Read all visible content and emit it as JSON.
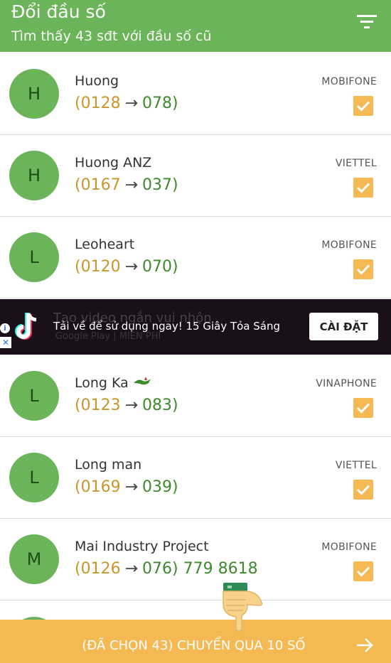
{
  "header": {
    "title": "Đổi đầu số",
    "subtitle": "Tìm thấy 43 sđt với đầu số cũ"
  },
  "contacts": [
    {
      "initial": "H",
      "name": "Huong",
      "old_prefix": "(0128",
      "new_prefix": "078)",
      "rest": "",
      "carrier": "MOBIFONE",
      "checked": true
    },
    {
      "initial": "H",
      "name": "Huong ANZ",
      "old_prefix": "(0167",
      "new_prefix": "037)",
      "rest": "",
      "carrier": "VIETTEL",
      "checked": true
    },
    {
      "initial": "L",
      "name": "Leoheart",
      "old_prefix": "(0120",
      "new_prefix": "070)",
      "rest": "",
      "carrier": "MOBIFONE",
      "checked": true
    },
    {
      "initial": "L",
      "name": "Long Ka",
      "old_prefix": "(0123",
      "new_prefix": "083)",
      "rest": "",
      "carrier": "VINAPHONE",
      "checked": true
    },
    {
      "initial": "L",
      "name": "Long man",
      "old_prefix": "(0169",
      "new_prefix": "039)",
      "rest": "",
      "carrier": "VIETTEL",
      "checked": true
    },
    {
      "initial": "M",
      "name": "Mai Industry Project",
      "old_prefix": "(0126",
      "new_prefix": "076)",
      "rest": " 779 8618",
      "carrier": "MOBIFONE",
      "checked": true
    }
  ],
  "arrow_glyph": "→",
  "ad": {
    "background_text": "Tạo video ngắn vui nhộn",
    "background_subtext": "Google Play  |  MIỄN PHÍ",
    "text": "Tải về để sử dụng ngay! 15 Giây Tỏa Sáng",
    "install_label": "CÀI ĐẶT"
  },
  "bottom_bar": {
    "label": "(ĐÃ CHỌN 43) CHUYỂN QUA 10 SỐ"
  },
  "colors": {
    "primary": "#6cb459",
    "accent": "#f5b954",
    "old_prefix": "#c8962c",
    "new_prefix": "#3d8a2c"
  },
  "icons": {
    "filter": "filter-icon",
    "check": "checkbox-checked-icon",
    "next": "arrow-right-icon",
    "ad_logo": "tiktok-logo-icon"
  }
}
